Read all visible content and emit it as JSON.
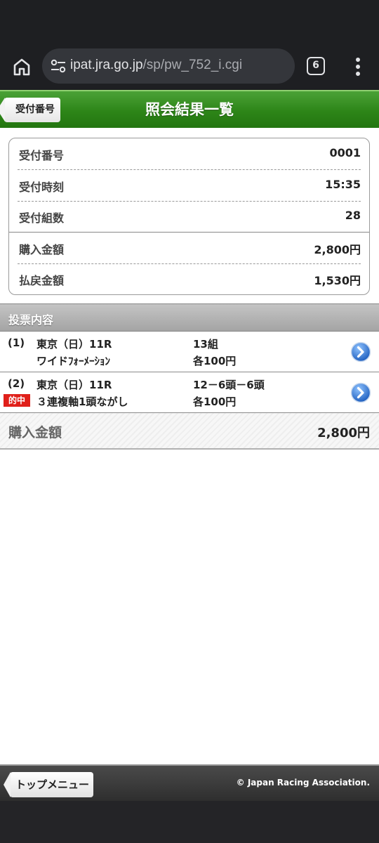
{
  "browser": {
    "url_domain": "ipat.jra.go.jp",
    "url_path": "/sp/pw_752_i.cgi",
    "tab_count": "6",
    "icons": [
      "home-icon",
      "site-settings-icon",
      "tabs-icon",
      "more-vert-icon"
    ]
  },
  "header": {
    "back_label": "受付番号",
    "title": "照会結果一覧"
  },
  "summary": {
    "receipt_no_label": "受付番号",
    "receipt_no": "0001",
    "receipt_time_label": "受付時刻",
    "receipt_time": "15:35",
    "combo_count_label": "受付組数",
    "combo_count": "28",
    "purchase_label": "購入金額",
    "purchase": "2,800円",
    "payout_label": "払戻金額",
    "payout": "1,530円"
  },
  "bets": {
    "section_title": "投票内容",
    "items": [
      {
        "num": "(1)",
        "race": "東京（日）11R",
        "type": "ワイドﾌｫｰﾒｰｼｮﾝ",
        "combo": "13組",
        "unit": "各100円",
        "hit": ""
      },
      {
        "num": "(2)",
        "race": "東京（日）11R",
        "type": "３連複軸1頭ながし",
        "combo": "12－6頭－6頭",
        "unit": "各100円",
        "hit": "的中"
      }
    ]
  },
  "total": {
    "label": "購入金額",
    "value": "2,800円"
  },
  "footer": {
    "top_menu_label": "トップメニュー",
    "copyright": "© Japan Racing Association."
  },
  "colors": {
    "header_green": "#2d8518",
    "hit_red": "#e0201a",
    "detail_blue": "#2a6fd0"
  }
}
